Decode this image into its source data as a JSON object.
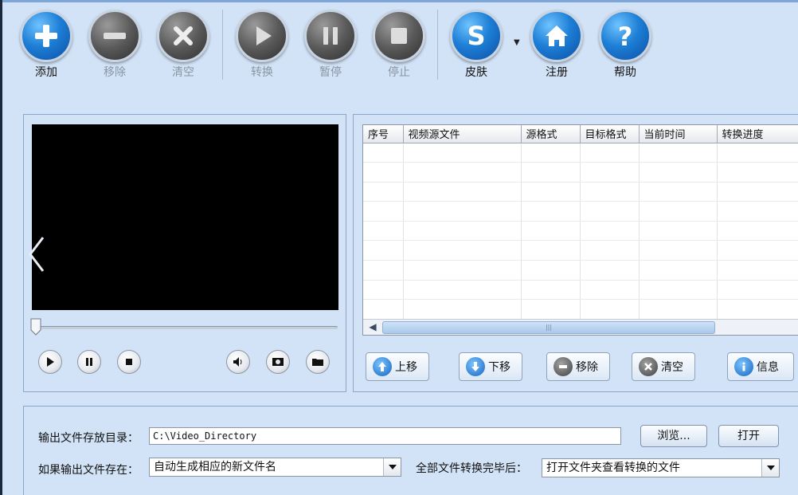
{
  "toolbar": {
    "add": "添加",
    "remove": "移除",
    "clear": "清空",
    "convert": "转换",
    "pause": "暂停",
    "stop": "停止",
    "skin": "皮肤",
    "register": "注册",
    "help": "帮助"
  },
  "file_table": {
    "columns": [
      "序号",
      "视频源文件",
      "源格式",
      "目标格式",
      "当前时间",
      "转换进度"
    ],
    "rows": [],
    "scrollbar_glyph": "|||"
  },
  "list_buttons": {
    "move_up": "上移",
    "move_down": "下移",
    "remove": "移除",
    "clear": "清空",
    "info": "信息"
  },
  "output": {
    "dir_label": "输出文件存放目录：",
    "dir_value": "C:\\Video_Directory",
    "browse": "浏览...",
    "open": "打开",
    "exists_label": "如果输出文件存在：",
    "exists_value": "自动生成相应的新文件名",
    "after_label": "全部文件转换完毕后：",
    "after_value": "打开文件夹查看转换的文件"
  },
  "colors": {
    "background": "#d2e3f7",
    "accent_blue": "#1e7fd6",
    "disabled_gray": "#5a5a5a"
  }
}
